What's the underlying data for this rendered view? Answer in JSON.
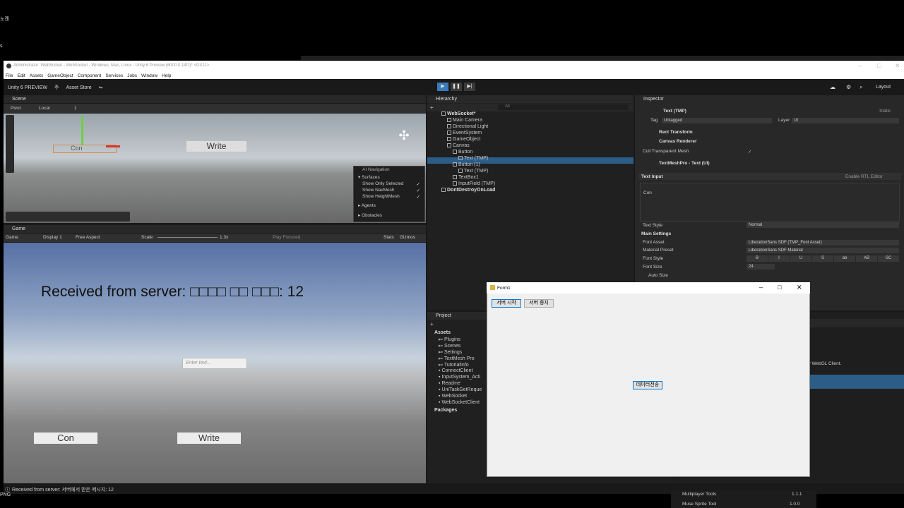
{
  "desktop": {
    "label_top": "노켄",
    "label_bottom": "s"
  },
  "window": {
    "title": "Administrator: WebSocket - WebSocket - Windows, Mac, Linux - Unity 6 Preview (6000.0.14f1)* <DX11>"
  },
  "menu": [
    "File",
    "Edit",
    "Assets",
    "GameObject",
    "Component",
    "Services",
    "Jobs",
    "Window",
    "Help"
  ],
  "toolbar": {
    "logo": "Unity 6 PREVIEW",
    "account": "주",
    "asset_store": "Asset Store",
    "layout": "Layout"
  },
  "scene": {
    "tab": "Scene",
    "pivot": "Pivot",
    "local": "Local",
    "number": "1",
    "write_label": "Write",
    "con_label": "Con",
    "ai_nav": {
      "title": "AI Navigation",
      "surfaces": "Surfaces",
      "items": [
        "Show Only Selected",
        "Show NavMesh",
        "Show HeightMesh"
      ],
      "agents": "Agents",
      "obstacles": "Obstacles"
    }
  },
  "game": {
    "tab": "Game",
    "mode": "Game",
    "display": "Display 1",
    "aspect": "Free Aspect",
    "scale_label": "Scale",
    "scale_value": "1.3x",
    "play_focused": "Play Focused",
    "stats": "Stats",
    "gizmos": "Gizmos",
    "received_text": "Received from server: □□□□ □□ □□□: 12",
    "input_placeholder": "Enter text...",
    "con_button": "Con",
    "write_button": "Write"
  },
  "hierarchy": {
    "tab": "Hierarchy",
    "search_placeholder": "All",
    "items": [
      {
        "label": "WebSocket*",
        "depth": 0
      },
      {
        "label": "Main Camera",
        "depth": 1
      },
      {
        "label": "Directional Light",
        "depth": 1
      },
      {
        "label": "EventSystem",
        "depth": 1
      },
      {
        "label": "GameObject",
        "depth": 1
      },
      {
        "label": "Canvas",
        "depth": 1
      },
      {
        "label": "Button",
        "depth": 2
      },
      {
        "label": "Text (TMP)",
        "depth": 3
      },
      {
        "label": "Button (1)",
        "depth": 2
      },
      {
        "label": "Text (TMP)",
        "depth": 3
      },
      {
        "label": "TextBox1",
        "depth": 2
      },
      {
        "label": "InputField (TMP)",
        "depth": 2
      },
      {
        "label": "DontDestroyOnLoad",
        "depth": 0
      }
    ]
  },
  "inspector": {
    "tab": "Inspector",
    "object_name": "Text (TMP)",
    "static": "Static",
    "tag_label": "Tag",
    "tag_value": "Untagged",
    "layer_label": "Layer",
    "layer_value": "UI",
    "components": [
      "Rect Transform",
      "Canvas Renderer",
      "TextMeshPro - Text (UI)"
    ],
    "cull": "Cull Transparent Mesh",
    "text_input": "Text Input",
    "rtl": "Enable RTL Editor",
    "text_value": "Con",
    "text_style_label": "Text Style",
    "text_style_value": "Normal",
    "main_settings": "Main Settings",
    "font_asset_label": "Font Asset",
    "font_asset_value": "LiberationSans SDF (TMP_Font Asset)",
    "material_label": "Material Preset",
    "material_value": "LiberationSans SDF Material",
    "font_style_label": "Font Style",
    "font_style_buttons": [
      "B",
      "I",
      "U",
      "S",
      "ab",
      "AB",
      "SC"
    ],
    "font_size_label": "Font Size",
    "font_size_value": "24",
    "auto_size": "Auto Size"
  },
  "project": {
    "tab": "Project",
    "assets": "Assets",
    "items": [
      "Plugins",
      "Scenes",
      "Settings",
      "TextMesh Pro",
      "TutorialInfo",
      "ConnectClient",
      "InputSystem_Acti",
      "Readme",
      "UniTaskGetReque",
      "WebSocket",
      "WebSocketClient"
    ],
    "packages": "Packages",
    "right_text": "rity WebGL Client."
  },
  "packages": [
    {
      "name": "Multiplayer Tools",
      "version": "1.1.1"
    },
    {
      "name": "Muse Sprite Tool",
      "version": "1.0.0"
    }
  ],
  "status": {
    "message": "Received from server: 서버에서 받은 메시지: 12"
  },
  "form": {
    "title": "Form1",
    "start_button": "서버 시작",
    "stop_button": "서버 중지",
    "send_button": "데이터전송"
  }
}
